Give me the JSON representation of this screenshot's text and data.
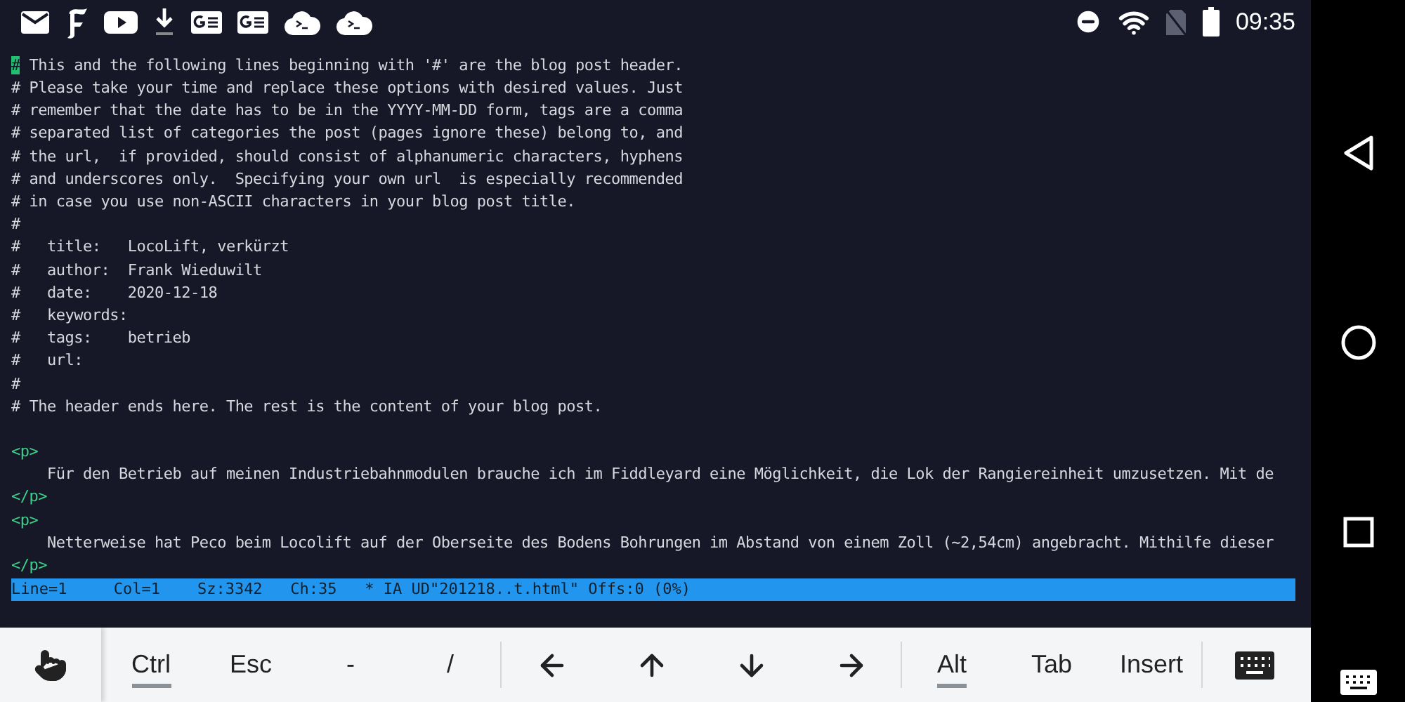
{
  "status_bar": {
    "notifications": [
      {
        "kind": "mail"
      },
      {
        "kind": "fraktur"
      },
      {
        "kind": "video"
      },
      {
        "kind": "download"
      },
      {
        "kind": "translate"
      },
      {
        "kind": "translate"
      },
      {
        "kind": "terminal"
      },
      {
        "kind": "terminal"
      }
    ],
    "indicators": [
      {
        "kind": "dnd"
      },
      {
        "kind": "wifi"
      },
      {
        "kind": "nosim"
      },
      {
        "kind": "battery"
      }
    ],
    "time": "09:35"
  },
  "editor": {
    "lines": [
      {
        "kind": "comment",
        "cursor": "#",
        "text": " This and the following lines beginning with '#' are the blog post header."
      },
      {
        "kind": "comment",
        "text": "# Please take your time and replace these options with desired values. Just"
      },
      {
        "kind": "comment",
        "text": "# remember that the date has to be in the YYYY-MM-DD form, tags are a comma"
      },
      {
        "kind": "comment",
        "text": "# separated list of categories the post (pages ignore these) belong to, and"
      },
      {
        "kind": "comment",
        "text": "# the url,  if provided, should consist of alphanumeric characters, hyphens"
      },
      {
        "kind": "comment",
        "text": "# and underscores only.  Specifying your own url  is especially recommended"
      },
      {
        "kind": "comment",
        "text": "# in case you use non-ASCII characters in your blog post title."
      },
      {
        "kind": "comment",
        "text": "#"
      },
      {
        "kind": "comment",
        "text": "#   title:   LocoLift, verkürzt"
      },
      {
        "kind": "comment",
        "text": "#   author:  Frank Wieduwilt"
      },
      {
        "kind": "comment",
        "text": "#   date:    2020-12-18"
      },
      {
        "kind": "comment",
        "text": "#   keywords:"
      },
      {
        "kind": "comment",
        "text": "#   tags:    betrieb"
      },
      {
        "kind": "comment",
        "text": "#   url:"
      },
      {
        "kind": "comment",
        "text": "#"
      },
      {
        "kind": "comment",
        "text": "# The header ends here. The rest is the content of your blog post."
      },
      {
        "kind": "blank"
      },
      {
        "kind": "tag",
        "text": "<p>"
      },
      {
        "kind": "text",
        "text": "    Für den Betrieb auf meinen Industriebahnmodulen brauche ich im Fiddleyard eine Möglichkeit, die Lok der Rangiereinheit umzusetzen. Mit de"
      },
      {
        "kind": "tag",
        "text": "</p>"
      },
      {
        "kind": "tag",
        "text": "<p>"
      },
      {
        "kind": "text",
        "text": "    Netterweise hat Peco beim Locolift auf der Oberseite des Bodens Bohrungen im Abstand von einem Zoll (~2,54cm) angebracht. Mithilfe dieser"
      },
      {
        "kind": "tag",
        "text": "</p>"
      }
    ],
    "status_line": "Line=1     Col=1    Sz:3342   Ch:35   * IA UD\"201218..t.html\" Offs:0 (0%)"
  },
  "keys": [
    {
      "kind": "touch"
    },
    {
      "kind": "text",
      "label": "Ctrl",
      "active": true
    },
    {
      "kind": "text",
      "label": "Esc",
      "active": false
    },
    {
      "kind": "text",
      "label": "-",
      "active": false
    },
    {
      "kind": "text",
      "label": "/",
      "active": false
    },
    {
      "kind": "divider"
    },
    {
      "kind": "left"
    },
    {
      "kind": "up"
    },
    {
      "kind": "down"
    },
    {
      "kind": "right"
    },
    {
      "kind": "divider"
    },
    {
      "kind": "text",
      "label": "Alt",
      "active": true
    },
    {
      "kind": "text",
      "label": "Tab",
      "active": false
    },
    {
      "kind": "text",
      "label": "Insert",
      "active": false
    },
    {
      "kind": "divider"
    },
    {
      "kind": "keyboard"
    }
  ],
  "nav_bar": [
    {
      "kind": "back"
    },
    {
      "kind": "home"
    },
    {
      "kind": "recents"
    },
    {
      "kind": "keyboard"
    }
  ]
}
